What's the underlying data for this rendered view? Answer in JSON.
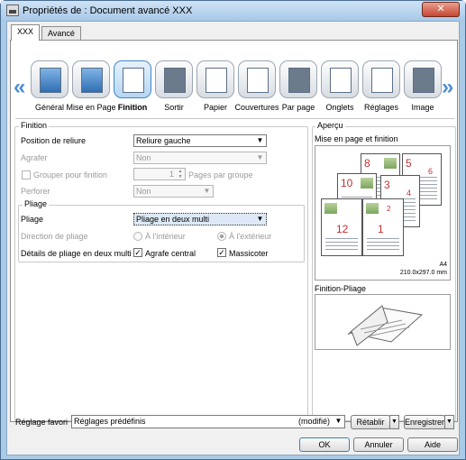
{
  "window": {
    "title": "Propriétés de : Document avancé XXX",
    "close_label": "✕"
  },
  "tabs": [
    {
      "label": "XXX"
    },
    {
      "label": "Avancé"
    }
  ],
  "categories": [
    {
      "label": "Général",
      "icon": "general-icon"
    },
    {
      "label": "Mise en Page",
      "icon": "layout-icon"
    },
    {
      "label": "Finition",
      "icon": "finishing-icon",
      "selected": true
    },
    {
      "label": "Sortir",
      "icon": "output-icon"
    },
    {
      "label": "Papier",
      "icon": "paper-icon"
    },
    {
      "label": "Couvertures",
      "icon": "covers-icon"
    },
    {
      "label": "Par page",
      "icon": "per-page-icon"
    },
    {
      "label": "Onglets",
      "icon": "tabs-icon"
    },
    {
      "label": "Réglages",
      "icon": "settings-icon"
    },
    {
      "label": "Image",
      "icon": "image-icon"
    }
  ],
  "nav": {
    "left": "«",
    "right": "»"
  },
  "finition": {
    "title": "Finition",
    "binding_position_label": "Position de reliure",
    "binding_position_value": "Reliure gauche",
    "staple_label": "Agrafer",
    "staple_value": "Non",
    "group_label": "Grouper pour finition",
    "group_value": "1",
    "group_unit": "Pages par groupe",
    "punch_label": "Perforer",
    "punch_value": "Non"
  },
  "pliage": {
    "title": "Pliage",
    "fold_label": "Pliage",
    "fold_value": "Pliage en deux multi",
    "direction_label": "Direction de pliage",
    "direction_inside": "À l'intérieur",
    "direction_outside": "À l'extérieur",
    "details_label": "Détails de pliage en deux multi",
    "center_staple_label": "Agrafe central",
    "trim_label": "Massicoter"
  },
  "preview": {
    "title": "Aperçu",
    "layout_label": "Mise en page et finition",
    "paper_size": "A4",
    "paper_dims": "210.0x297.0 mm",
    "fold_label": "Finition-Pliage",
    "page_numbers": [
      "8",
      "5",
      "6",
      "10",
      "3",
      "4",
      "12",
      "1",
      "2"
    ]
  },
  "bottom": {
    "favorite_label": "Réglage favori",
    "favorite_value": "Réglages prédéfinis",
    "favorite_modified": "(modifié)",
    "restore_label": "Rétablir",
    "save_label": "Enregistrer",
    "ok_label": "OK",
    "cancel_label": "Annuler",
    "help_label": "Aide"
  }
}
